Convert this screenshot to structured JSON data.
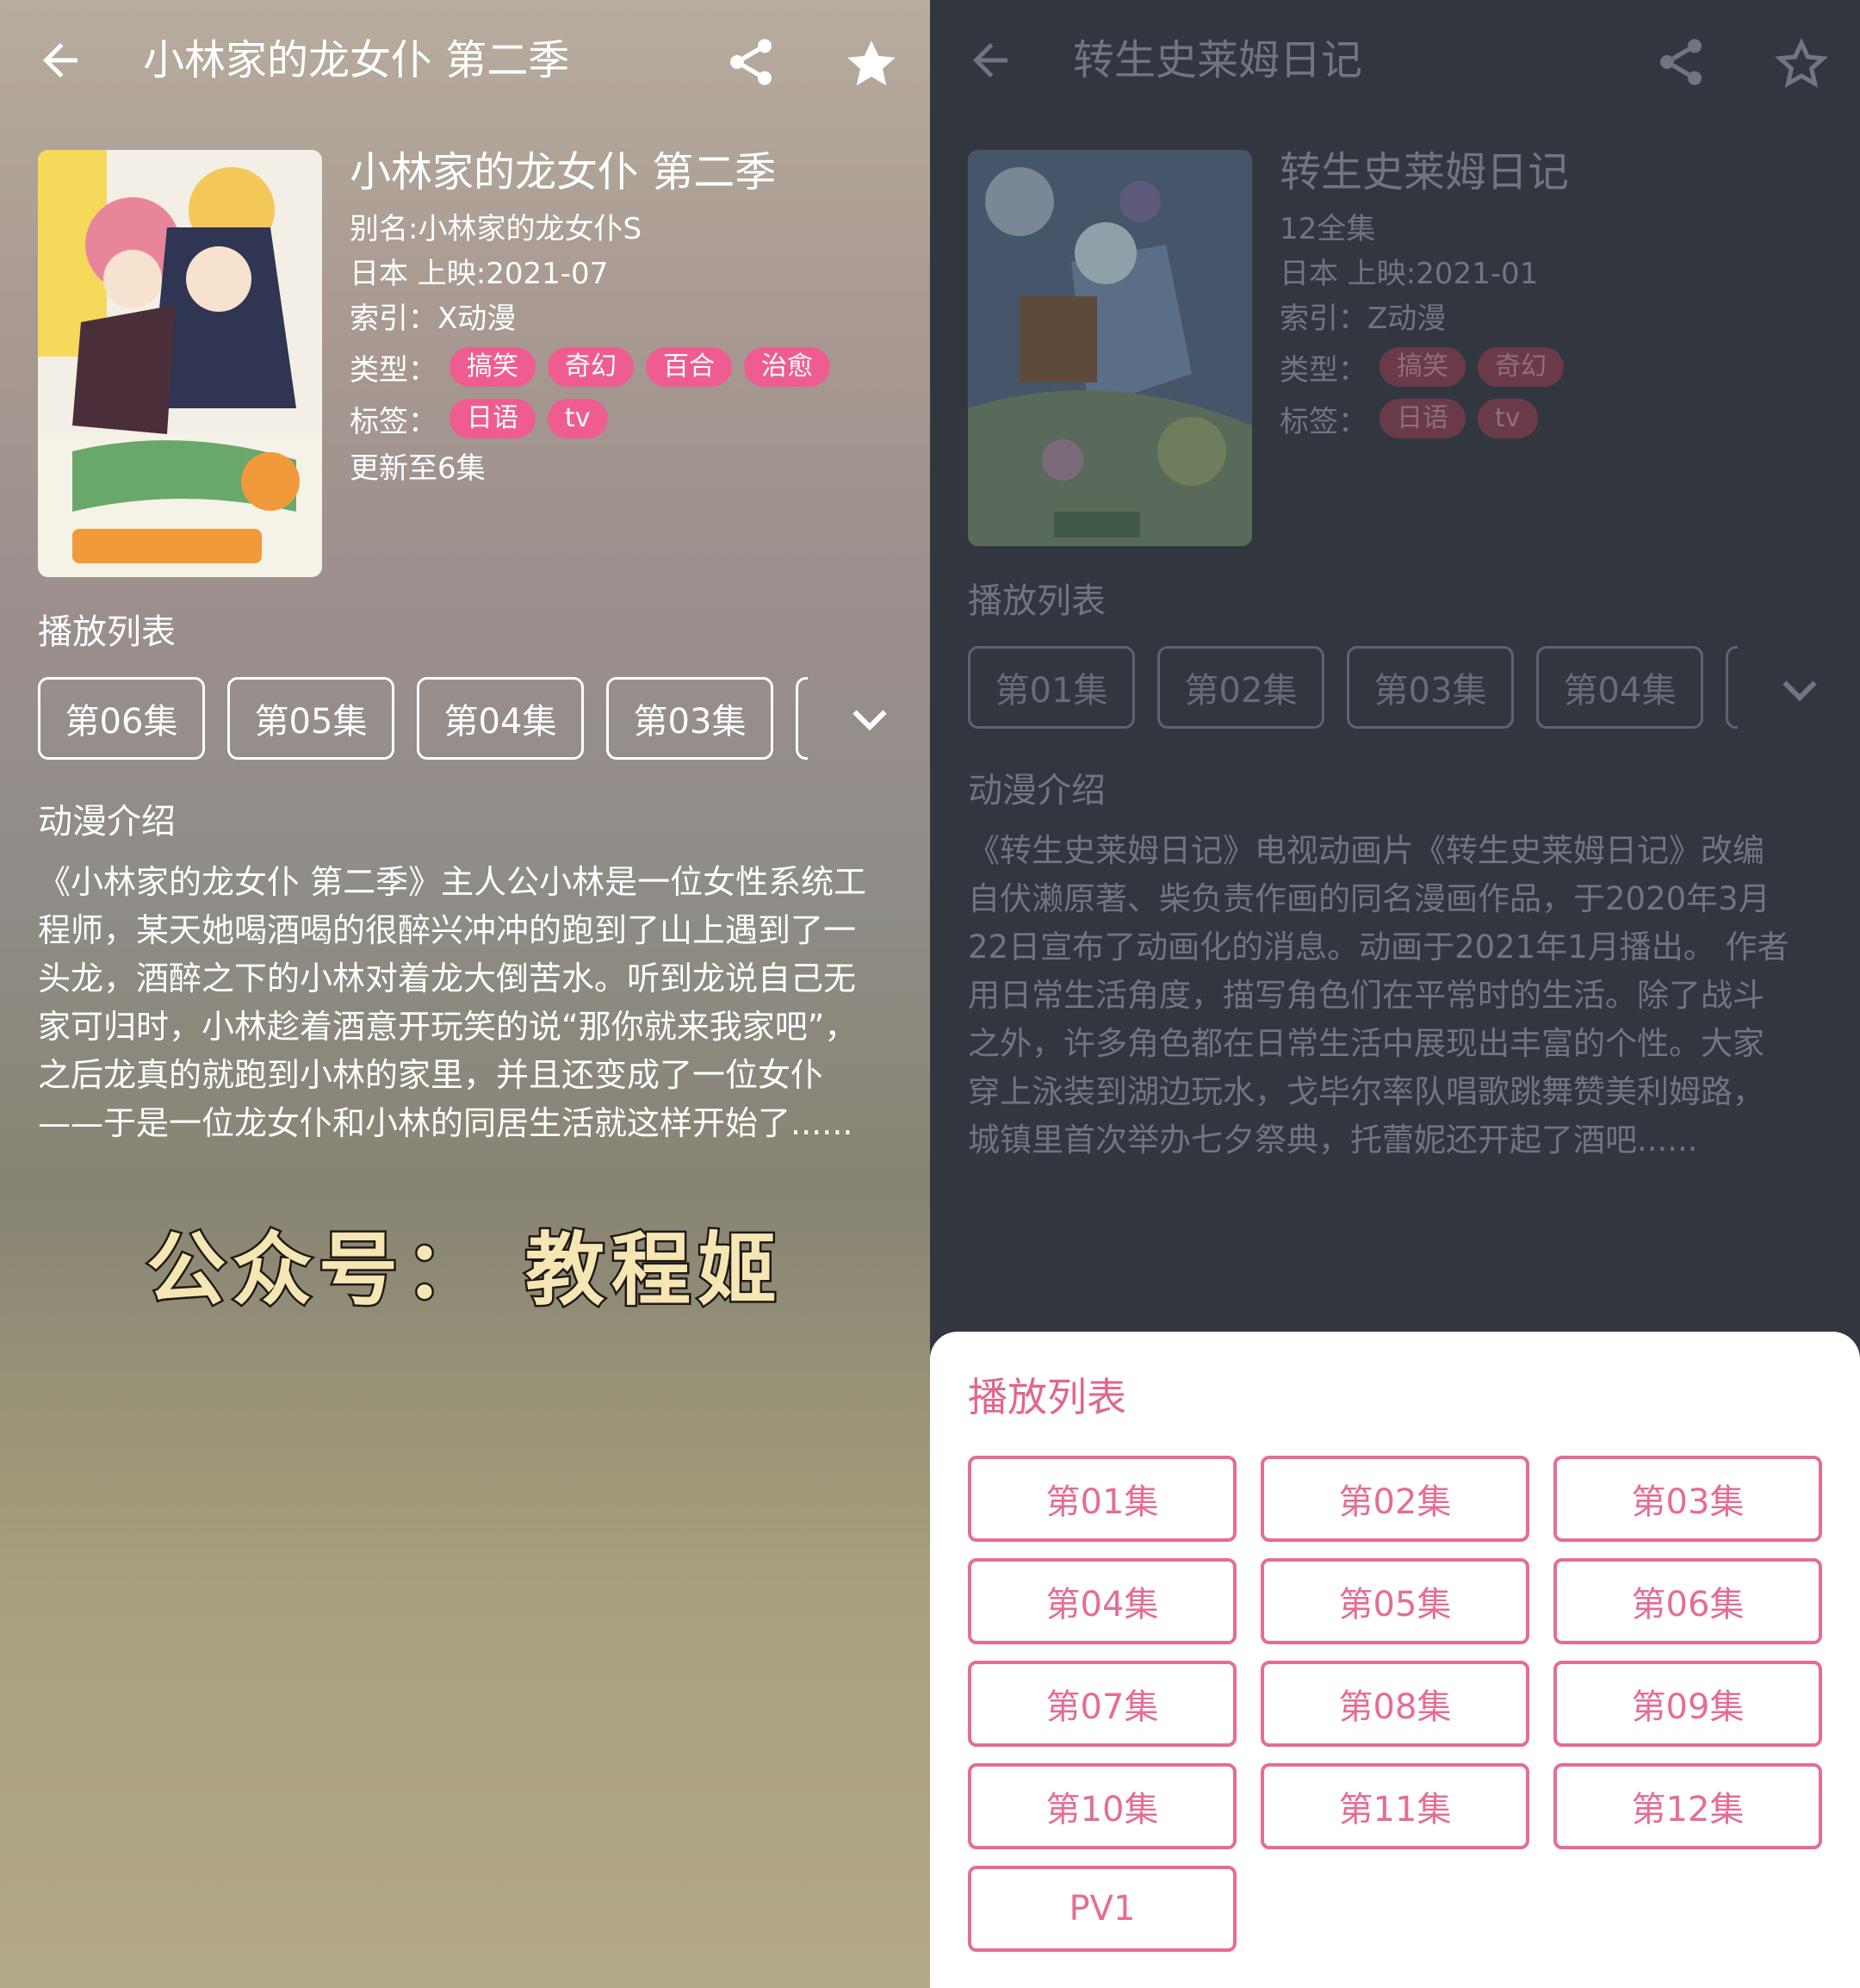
{
  "left": {
    "toolbar_title": "小林家的龙女仆 第二季",
    "title": "小林家的龙女仆 第二季",
    "alias": "别名:小林家的龙女仆S",
    "region_date": "日本   上映:2021-07",
    "index": "索引：X动漫",
    "genre_label": "类型：",
    "genres": [
      "搞笑",
      "奇幻",
      "百合",
      "治愈"
    ],
    "tags_label": "标签：",
    "tags": [
      "日语",
      "tv"
    ],
    "update": "更新至6集",
    "playlist_heading": "播放列表",
    "episodes": [
      "第06集",
      "第05集",
      "第04集",
      "第03集"
    ],
    "intro_heading": "动漫介绍",
    "intro_lines": [
      "《小林家的龙女仆 第二季》主人公小林是一位女性系统工",
      "程师，某天她喝酒喝的很醉兴冲冲的跑到了山上遇到了一",
      "头龙，酒醉之下的小林对着龙大倒苦水。听到龙说自己无",
      "家可归时，小林趁着酒意开玩笑的说“那你就来我家吧”，",
      "之后龙真的就跑到小林的家里，并且还变成了一位女仆",
      "——于是一位龙女仆和小林的同居生活就这样开始了......"
    ],
    "watermark": "公众号： 教程姬"
  },
  "right": {
    "toolbar_title": "转生史莱姆日记",
    "title": "转生史莱姆日记",
    "episodes_total": "12全集",
    "region_date": "日本   上映:2021-01",
    "index": "索引：Z动漫",
    "genre_label": "类型：",
    "genres": [
      "搞笑",
      "奇幻"
    ],
    "tags_label": "标签：",
    "tags": [
      "日语",
      "tv"
    ],
    "playlist_heading": "播放列表",
    "episodes": [
      "第01集",
      "第02集",
      "第03集",
      "第04集"
    ],
    "intro_heading": "动漫介绍",
    "intro_lines": [
      "《转生史莱姆日记》电视动画片《转生史莱姆日记》改编",
      "自伏濑原著、柴负责作画的同名漫画作品，于2020年3月",
      "22日宣布了动画化的消息。动画于2021年1月播出。 作者",
      "用日常生活角度，描写角色们在平常时的生活。除了战斗",
      "之外，许多角色都在日常生活中展现出丰富的个性。大家",
      "穿上泳装到湖边玩水，戈毕尔率队唱歌跳舞赞美利姆路，",
      "城镇里首次举办七夕祭典，托蕾妮还开起了酒吧......"
    ],
    "sheet": {
      "heading": "播放列表",
      "episodes": [
        "第01集",
        "第02集",
        "第03集",
        "第04集",
        "第05集",
        "第06集",
        "第07集",
        "第08集",
        "第09集",
        "第10集",
        "第11集",
        "第12集",
        "PV1"
      ]
    }
  },
  "colors": {
    "accent_pink": "#e56d93",
    "tag_pink": "#ef5d90",
    "dim_bg": "#32373f"
  },
  "icons": [
    "back-arrow-icon",
    "share-icon",
    "star-icon",
    "chevron-down-icon"
  ]
}
